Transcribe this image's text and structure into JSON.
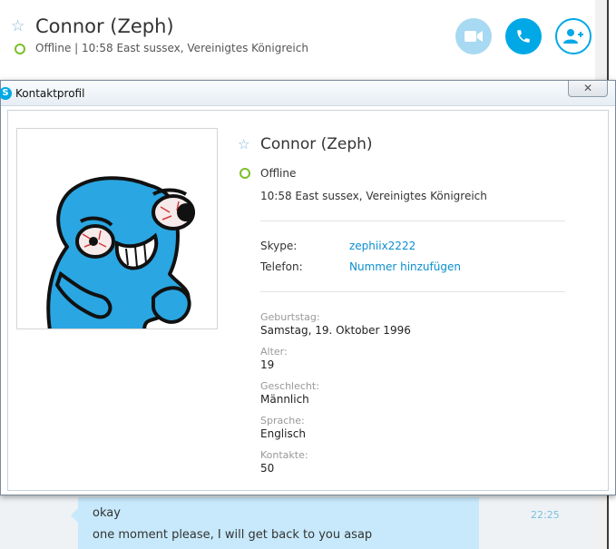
{
  "header": {
    "contact_name": "Connor (Zeph)",
    "status_line": "Offline  |  10:58 East sussex, Vereinigtes Königreich",
    "status_color": "#7cbf2a",
    "icons": {
      "favorite": "star-outline-icon",
      "video": "video-camera-icon",
      "call": "phone-icon",
      "add_contact": "add-person-icon"
    },
    "accent_color": "#00a8e6"
  },
  "dialog": {
    "title": "Kontaktprofil",
    "close_label": "✕",
    "profile": {
      "name": "Connor (Zeph)",
      "status": "Offline",
      "location": "10:58 East sussex, Vereinigtes Königreich",
      "skype_label": "Skype:",
      "skype_value": "zephiix2222",
      "phone_label": "Telefon:",
      "phone_value": "Nummer hinzufügen",
      "fields": [
        {
          "label": "Geburtstag:",
          "value": "Samstag, 19. Oktober 1996"
        },
        {
          "label": "Alter:",
          "value": "19"
        },
        {
          "label": "Geschlecht:",
          "value": "Männlich"
        },
        {
          "label": "Sprache:",
          "value": "Englisch"
        },
        {
          "label": "Kontakte:",
          "value": "50"
        }
      ]
    }
  },
  "chat": {
    "messages": [
      "okay",
      "one moment please, I will get back to you asap"
    ],
    "time": "22:25"
  }
}
